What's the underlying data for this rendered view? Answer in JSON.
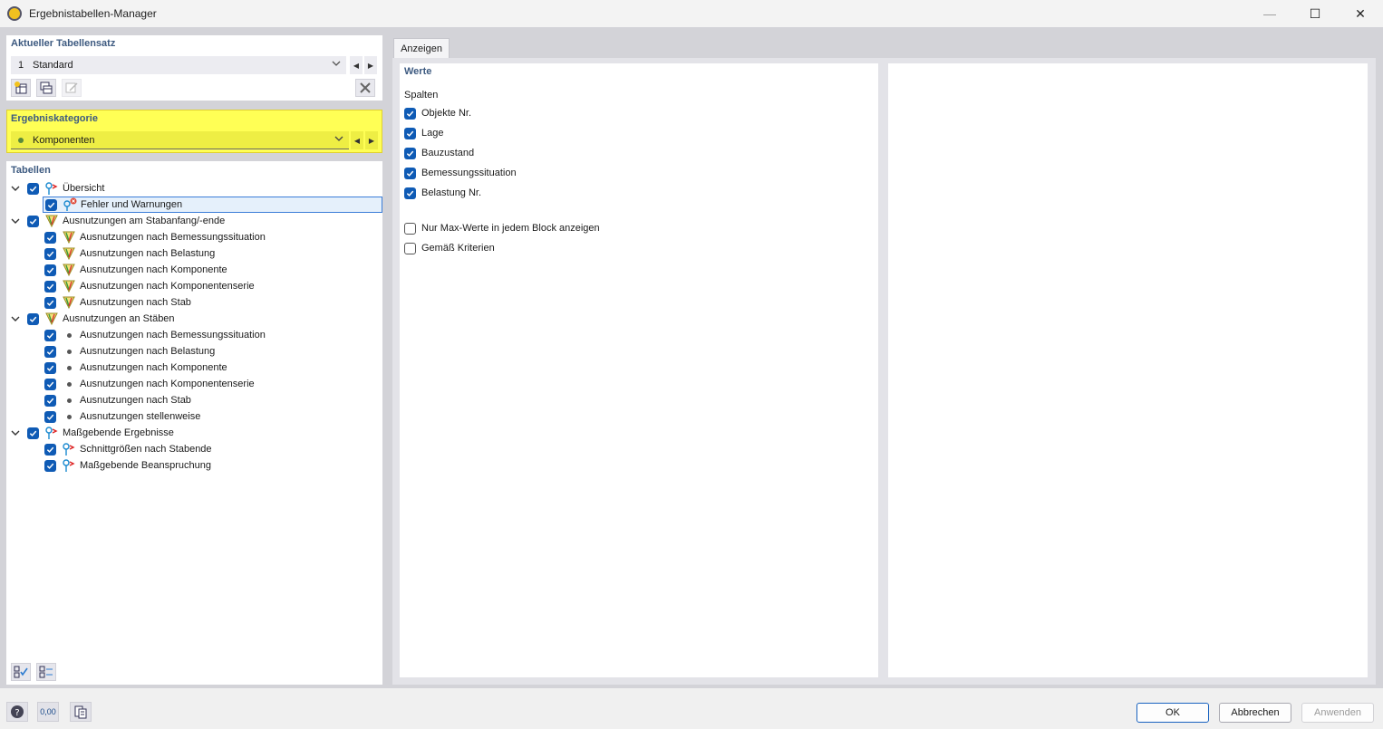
{
  "window": {
    "title": "Ergebnistabellen-Manager",
    "minimize": "—",
    "maximize": "☐",
    "close": "✕"
  },
  "tableset": {
    "label": "Aktueller Tabellensatz",
    "number": "1",
    "name": "Standard"
  },
  "category": {
    "label": "Ergebniskategorie",
    "value": "Komponenten",
    "highlight_color": "#ffff55"
  },
  "tables": {
    "label": "Tabellen",
    "groups": [
      {
        "label": "Übersicht",
        "items": [
          "Fehler und Warnungen"
        ]
      },
      {
        "label": "Ausnutzungen am Stabanfang/-ende",
        "items": [
          "Ausnutzungen nach Bemessungssituation",
          "Ausnutzungen nach Belastung",
          "Ausnutzungen nach Komponente",
          "Ausnutzungen nach Komponentenserie",
          "Ausnutzungen nach Stab"
        ]
      },
      {
        "label": "Ausnutzungen an Stäben",
        "items": [
          "Ausnutzungen nach Bemessungssituation",
          "Ausnutzungen nach Belastung",
          "Ausnutzungen nach Komponente",
          "Ausnutzungen nach Komponentenserie",
          "Ausnutzungen nach Stab",
          "Ausnutzungen stellenweise"
        ]
      },
      {
        "label": "Maßgebende Ergebnisse",
        "items": [
          "Schnittgrößen nach Stabende",
          "Maßgebende Beanspruchung"
        ]
      }
    ]
  },
  "anzeigen": {
    "tab_label": "Anzeigen",
    "section": "Werte",
    "columns_label": "Spalten",
    "columns": [
      {
        "label": "Objekte Nr.",
        "checked": true
      },
      {
        "label": "Lage",
        "checked": true
      },
      {
        "label": "Bauzustand",
        "checked": true
      },
      {
        "label": "Bemessungssituation",
        "checked": true
      },
      {
        "label": "Belastung Nr.",
        "checked": true
      }
    ],
    "options": [
      {
        "label": "Nur Max-Werte in jedem Block anzeigen",
        "checked": false
      },
      {
        "label": "Gemäß Kriterien",
        "checked": false
      }
    ]
  },
  "footer": {
    "decimal_icon_label": "0,00",
    "ok": "OK",
    "cancel": "Abbrechen",
    "apply": "Anwenden"
  },
  "colors": {
    "accent": "#0f5bb5",
    "section_label": "#3d5a80",
    "highlight": "#ffff55"
  }
}
